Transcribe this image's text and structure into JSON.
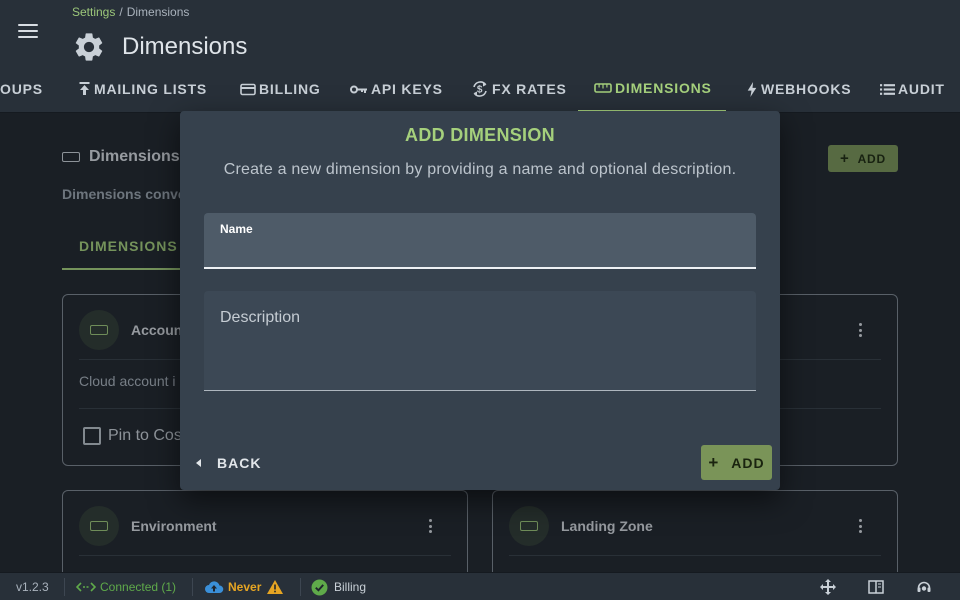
{
  "breadcrumb": {
    "parent": "Settings",
    "separator": "/",
    "current": "Dimensions"
  },
  "page": {
    "title": "Dimensions"
  },
  "tabs": [
    {
      "label": "OUPS",
      "icon": "none"
    },
    {
      "label": "MAILING LISTS",
      "icon": "upload-icon"
    },
    {
      "label": "BILLING",
      "icon": "credit-card-icon"
    },
    {
      "label": "API KEYS",
      "icon": "key-icon"
    },
    {
      "label": "FX RATES",
      "icon": "currency-exchange-icon"
    },
    {
      "label": "DIMENSIONS",
      "icon": "ruler-icon",
      "active": true
    },
    {
      "label": "WEBHOOKS",
      "icon": "lightning-icon"
    },
    {
      "label": "AUDIT",
      "icon": "list-icon"
    }
  ],
  "section": {
    "title": "Dimensions",
    "description": "Dimensions conver",
    "add_label": "ADD",
    "subtab": "DIMENSIONS"
  },
  "cards": [
    {
      "name": "Accoun",
      "description": "Cloud account i",
      "pin_label": "Pin to Cos"
    },
    {
      "name": "Environment"
    },
    {
      "name": "Landing Zone"
    }
  ],
  "dialog": {
    "title": "ADD DIMENSION",
    "subtitle": "Create a new dimension by providing a name and optional description.",
    "name_label": "Name",
    "name_value": "",
    "description_placeholder": "Description",
    "back_label": "BACK",
    "add_label": "ADD"
  },
  "statusbar": {
    "version": "v1.2.3",
    "connection": "Connected (1)",
    "sync": "Never",
    "billing": "Billing"
  },
  "colors": {
    "accent": "#a5d07c",
    "button": "#7a9458",
    "dialog_bg": "#36414d",
    "background": "#1f252d",
    "warning": "#e6a523",
    "success": "#5faa4a"
  }
}
